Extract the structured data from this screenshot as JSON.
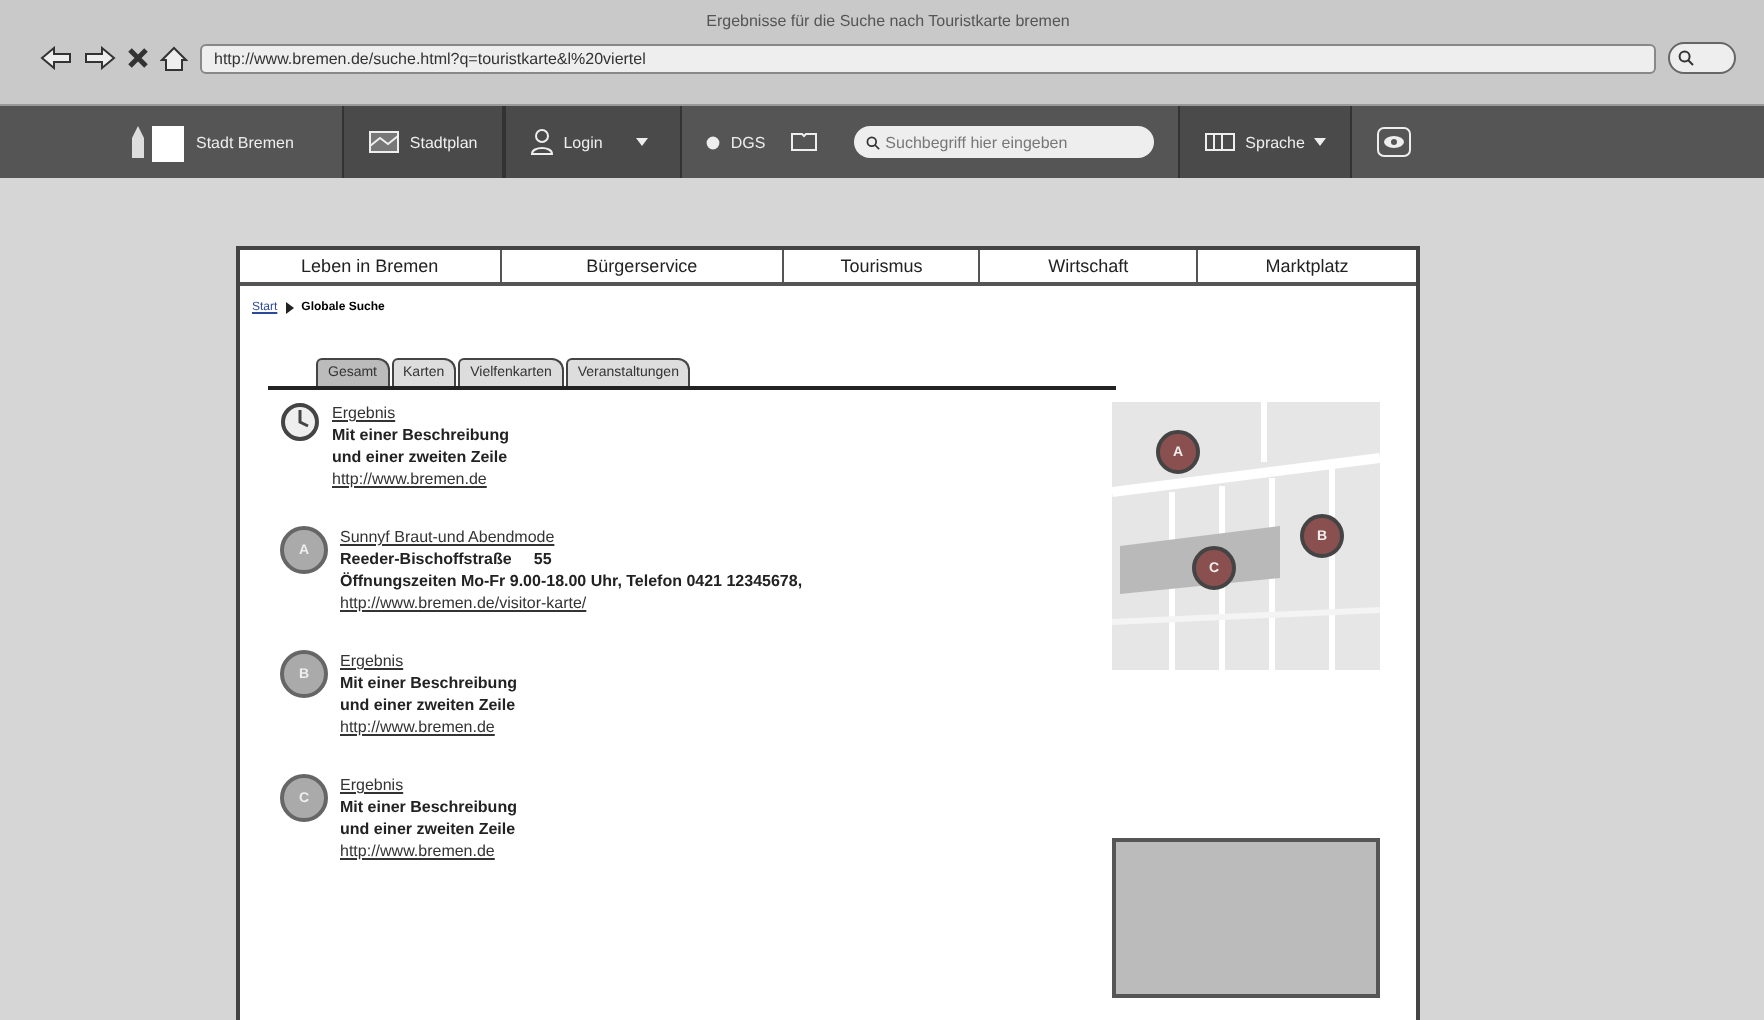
{
  "window": {
    "title": "Ergebnisse für die Suche nach Touristkarte bremen",
    "url": "http://www.bremen.de/suche.html?q=touristkarte&l%20viertel"
  },
  "toolbar": {
    "site_name": "Stadt Bremen",
    "map_button": "Stadtplan",
    "login_button": "Login",
    "dgs_button": "DGS",
    "search": {
      "placeholder": "Suchbegriff hier eingeben"
    },
    "language_button": "Sprache"
  },
  "nav": [
    {
      "label": "Leben in Bremen"
    },
    {
      "label": "Bürgerservice"
    },
    {
      "label": "Tourismus"
    },
    {
      "label": "Wirtschaft"
    },
    {
      "label": "Marktplatz"
    }
  ],
  "breadcrumb": [
    {
      "label": "Start",
      "kind": "link"
    },
    {
      "label": "Globale Suche",
      "kind": "current"
    }
  ],
  "tabs": [
    {
      "label": "Gesamt",
      "selected": true
    },
    {
      "label": "Karten",
      "selected": false
    },
    {
      "label": "Vielfenkarten",
      "selected": false
    },
    {
      "label": "Veranstaltungen",
      "selected": false
    }
  ],
  "results": [
    {
      "kind": "clock",
      "title": "Ergebnis",
      "lines": [
        "Mit einer Beschreibung",
        "und einer zweiten Zeile"
      ],
      "link": "http://www.bremen.de"
    },
    {
      "kind": "marker",
      "marker": "A",
      "title": "Sunnyf Braut-und Abendmode",
      "lines": [
        "Reeder-Bischoffstraße     55",
        "Öffnungszeiten Mo-Fr 9.00-18.00 Uhr, Telefon 0421 12345678,"
      ],
      "link": "http://www.bremen.de/visitor-karte/"
    },
    {
      "kind": "marker",
      "marker": "B",
      "title": "Ergebnis",
      "lines": [
        "Mit einer Beschreibung",
        "und einer zweiten Zeile"
      ],
      "link": "http://www.bremen.de"
    },
    {
      "kind": "marker",
      "marker": "C",
      "title": "Ergebnis",
      "lines": [
        "Mit einer Beschreibung",
        "und einer zweiten Zeile"
      ],
      "link": "http://www.bremen.de"
    }
  ],
  "map": {
    "markers": [
      "A",
      "B",
      "C"
    ]
  }
}
